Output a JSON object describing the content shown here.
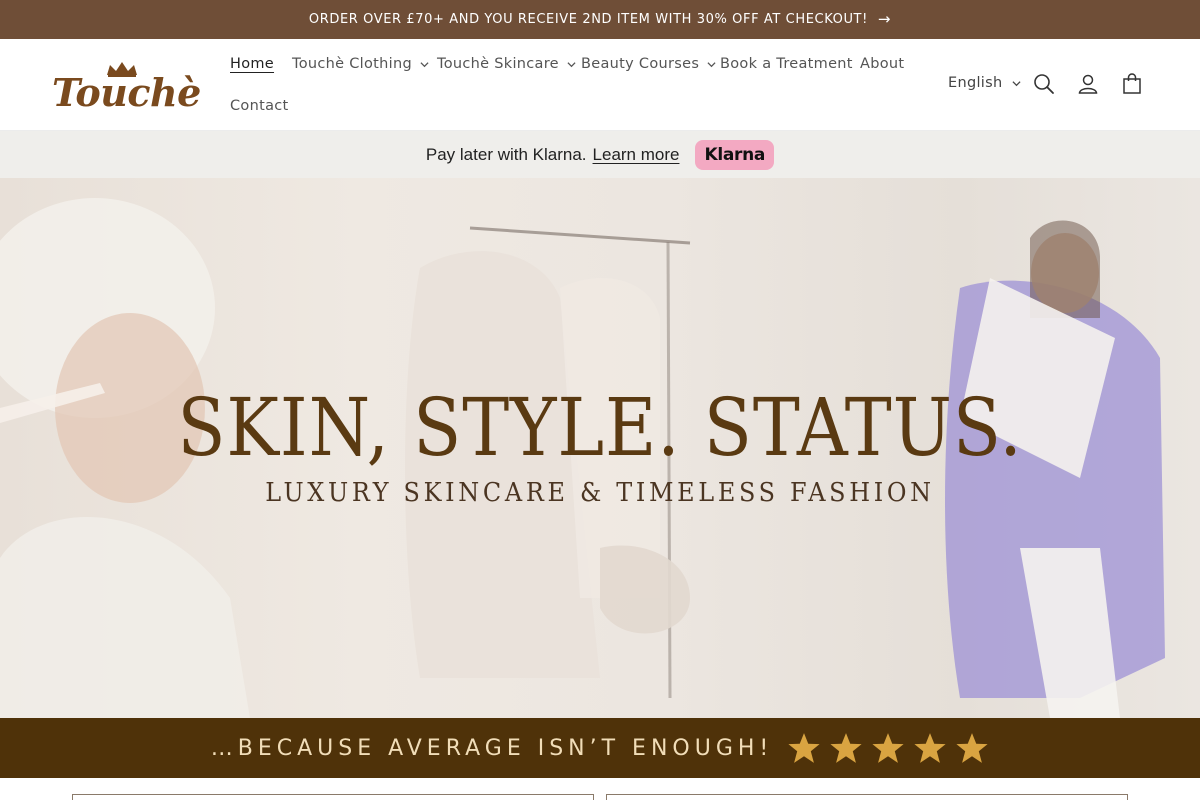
{
  "announcement": {
    "text": "ORDER OVER £70+ AND YOU RECEIVE 2ND ITEM WITH 30% OFF AT CHECKOUT!",
    "icon": "arrow-right-icon"
  },
  "brand": {
    "logo_text": "Touchè"
  },
  "nav": {
    "items": [
      {
        "label": "Home",
        "active": true,
        "dropdown": false
      },
      {
        "label": "Touchè Clothing",
        "dropdown": true
      },
      {
        "label": "Touchè Skincare",
        "dropdown": true
      },
      {
        "label": "Beauty Courses",
        "dropdown": true
      },
      {
        "label": "Book a Treatment",
        "dropdown": false
      },
      {
        "label": "About",
        "dropdown": false
      },
      {
        "label": "Contact",
        "dropdown": false
      }
    ]
  },
  "header_tools": {
    "language": "English",
    "icons": [
      "search-icon",
      "account-icon",
      "cart-icon"
    ]
  },
  "klarna": {
    "text": "Pay later with Klarna.",
    "link": "Learn more",
    "badge": "Klarna"
  },
  "hero": {
    "title": "SKIN, STYLE. STATUS.",
    "subtitle": "LUXURY SKINCARE & TIMELESS FASHION"
  },
  "tagline": {
    "text": "…BECAUSE AVERAGE ISN’T ENOUGH!",
    "stars": 5
  },
  "colors": {
    "announcement_bg": "#6f4e37",
    "brand_brown": "#7a4a1e",
    "tagline_bg": "#4f3209",
    "klarna_pink": "#f3a9c2",
    "star_gold": "#d9a441"
  }
}
